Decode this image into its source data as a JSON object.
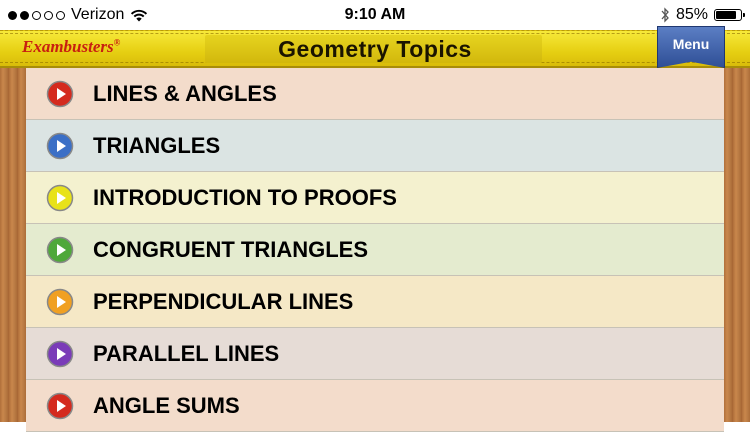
{
  "status_bar": {
    "carrier": "Verizon",
    "signal_bars_filled": 2,
    "signal_bars_total": 5,
    "time": "9:10 AM",
    "battery": "85%",
    "battery_level": 0.85
  },
  "header": {
    "brand": "Exambusters",
    "brand_mark": "®",
    "title": "Geometry Topics",
    "menu_label": "Menu"
  },
  "topics": [
    {
      "label": "LINES & ANGLES",
      "icon": "play-circle-icon",
      "icon_color": "#d42a1e",
      "row_color": "#f3dccb"
    },
    {
      "label": "TRIANGLES",
      "icon": "play-circle-icon",
      "icon_color": "#3b6fc6",
      "row_color": "#dbe4e3"
    },
    {
      "label": "INTRODUCTION TO PROOFS",
      "icon": "play-circle-icon",
      "icon_color": "#e8e21a",
      "row_color": "#f4f1cf"
    },
    {
      "label": "CONGRUENT TRIANGLES",
      "icon": "play-circle-icon",
      "icon_color": "#4fa83a",
      "row_color": "#e4ebcf"
    },
    {
      "label": "PERPENDICULAR LINES",
      "icon": "play-circle-icon",
      "icon_color": "#f0a022",
      "row_color": "#f5e8c6"
    },
    {
      "label": "PARALLEL LINES",
      "icon": "play-circle-icon",
      "icon_color": "#7a3bb8",
      "row_color": "#e6dcd6"
    },
    {
      "label": "ANGLE SUMS",
      "icon": "play-circle-icon",
      "icon_color": "#d42a1e",
      "row_color": "#f3dccb"
    }
  ]
}
